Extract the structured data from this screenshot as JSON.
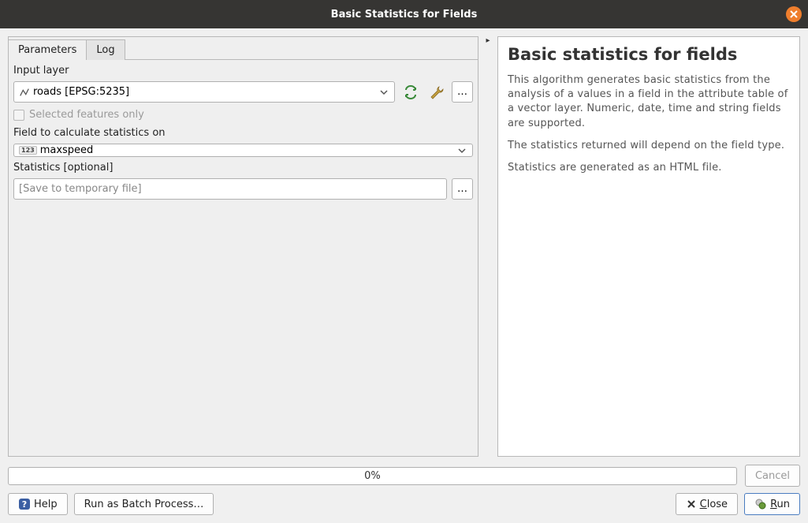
{
  "title": "Basic Statistics for Fields",
  "tabs": {
    "parameters": "Parameters",
    "log": "Log"
  },
  "params": {
    "input_layer_label": "Input layer",
    "input_layer_value": "roads [EPSG:5235]",
    "selected_only_label": "Selected features only",
    "field_label": "Field to calculate statistics on",
    "field_value": "maxspeed",
    "output_label": "Statistics [optional]",
    "output_placeholder": "[Save to temporary file]",
    "num_icon": "123"
  },
  "help": {
    "heading": "Basic statistics for fields",
    "p1": "This algorithm generates basic statistics from the analysis of a values in a field in the attribute table of a vector layer. Numeric, date, time and string fields are supported.",
    "p2": "The statistics returned will depend on the field type.",
    "p3": "Statistics are generated as an HTML file."
  },
  "progress": "0%",
  "buttons": {
    "cancel": "Cancel",
    "help": "Help",
    "batch": "Run as Batch Process…",
    "close": "Close",
    "close_u": "C",
    "close_rest": "lose",
    "run": "Run",
    "run_u": "R",
    "run_rest": "un"
  },
  "ellipsis": "…"
}
